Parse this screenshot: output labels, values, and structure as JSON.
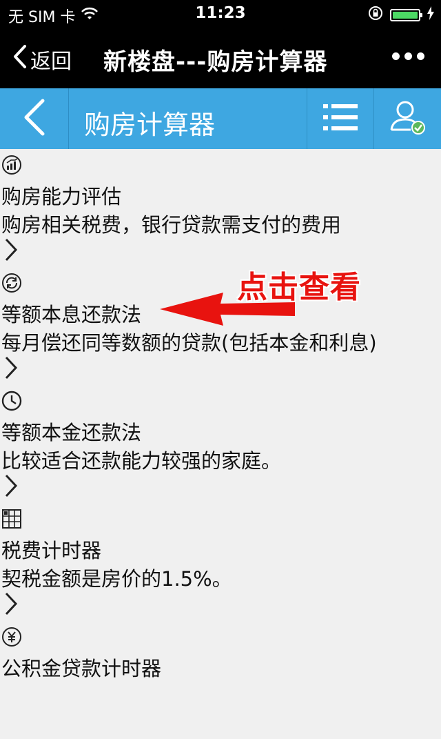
{
  "status_bar": {
    "carrier": "无 SIM 卡",
    "time": "11:23",
    "battery_level": 1.0
  },
  "nav_bar": {
    "back_label": "返回",
    "title": "新楼盘---购房计算器",
    "more_icon": "more-dots-icon"
  },
  "app_header": {
    "title": "购房计算器",
    "back_icon": "chevron-left-icon",
    "menu_icon": "list-menu-icon",
    "user_icon": "user-verified-icon"
  },
  "items": [
    {
      "icon": "chart-circle-icon",
      "title": "购房能力评估",
      "desc": "购房相关税费，银行贷款需支付的费用"
    },
    {
      "icon": "refresh-circle-icon",
      "title": "等额本息还款法",
      "desc": "每月偿还同等数额的贷款(包括本金和利息)"
    },
    {
      "icon": "clock-icon",
      "title": "等额本金还款法",
      "desc": "比较适合还款能力较强的家庭。"
    },
    {
      "icon": "calculator-grid-icon",
      "title": "税费计时器",
      "desc": "契税金额是房价的1.5%。"
    },
    {
      "icon": "money-circle-icon",
      "title": "公积金贷款计时器",
      "desc": ""
    }
  ],
  "annotation": {
    "text": "点击查看",
    "color": "#e8130f"
  },
  "colors": {
    "header_blue": "#3ea7e1",
    "battery_green": "#4cd964"
  }
}
